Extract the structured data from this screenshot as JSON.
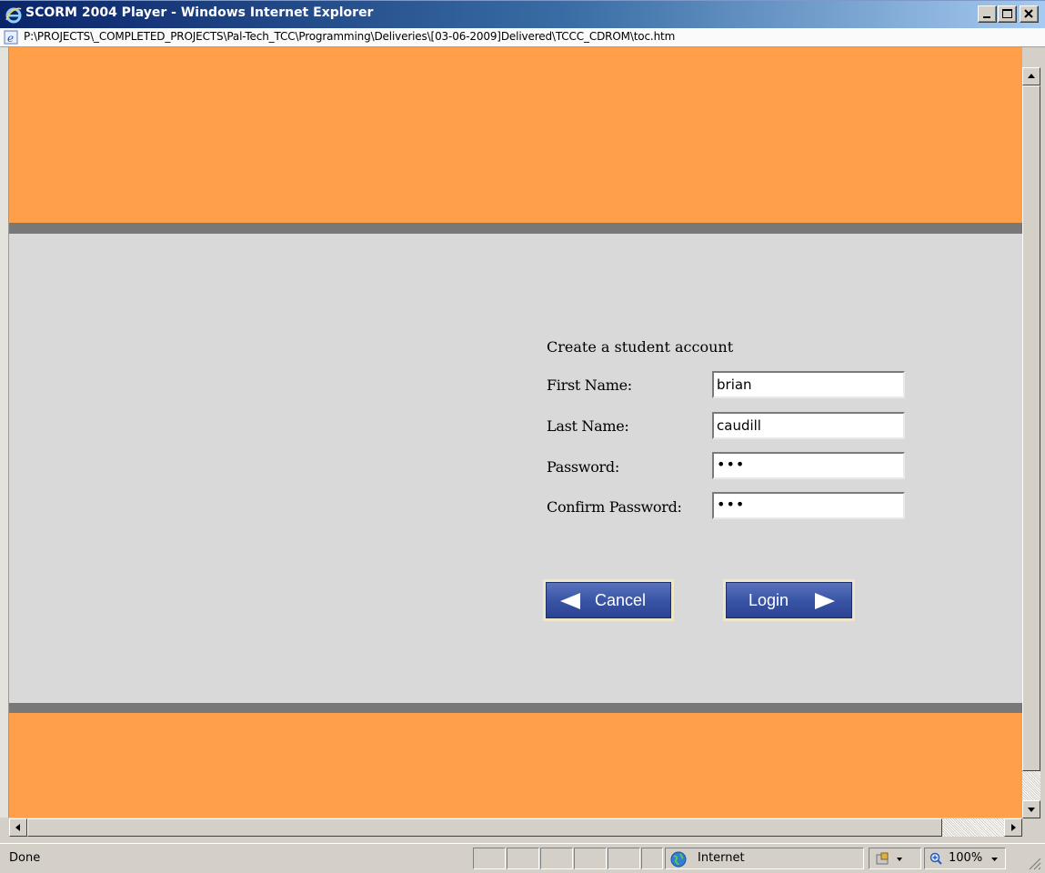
{
  "window": {
    "title": "SCORM 2004 Player - Windows Internet Explorer",
    "address": "P:\\PROJECTS\\_COMPLETED_PROJECTS\\Pal-Tech_TCC\\Programming\\Deliveries\\[03-06-2009]Delivered\\TCCC_CDROM\\toc.htm"
  },
  "colors": {
    "accent_orange": "#ff9f4a",
    "page_bg": "#d9d9d9",
    "separator": "#787878",
    "button_blue": "#3a55a6"
  },
  "form": {
    "title": "Create a student account",
    "fields": [
      {
        "label": "First Name:",
        "value": "brian"
      },
      {
        "label": "Last Name:",
        "value": "caudill"
      },
      {
        "label": "Password:",
        "value": "•••"
      },
      {
        "label": "Confirm Password:",
        "value": "•••"
      }
    ],
    "cancel_label": "Cancel",
    "login_label": "Login"
  },
  "status": {
    "text": "Done",
    "zone": "Internet",
    "zoom": "100%"
  },
  "icons": [
    "ie-logo-icon",
    "page-icon",
    "minimize-icon",
    "maximize-icon",
    "close-icon",
    "arrow-left-icon",
    "arrow-right-icon",
    "globe-icon",
    "protected-mode-icon",
    "zoom-icon",
    "resize-grip-icon"
  ]
}
